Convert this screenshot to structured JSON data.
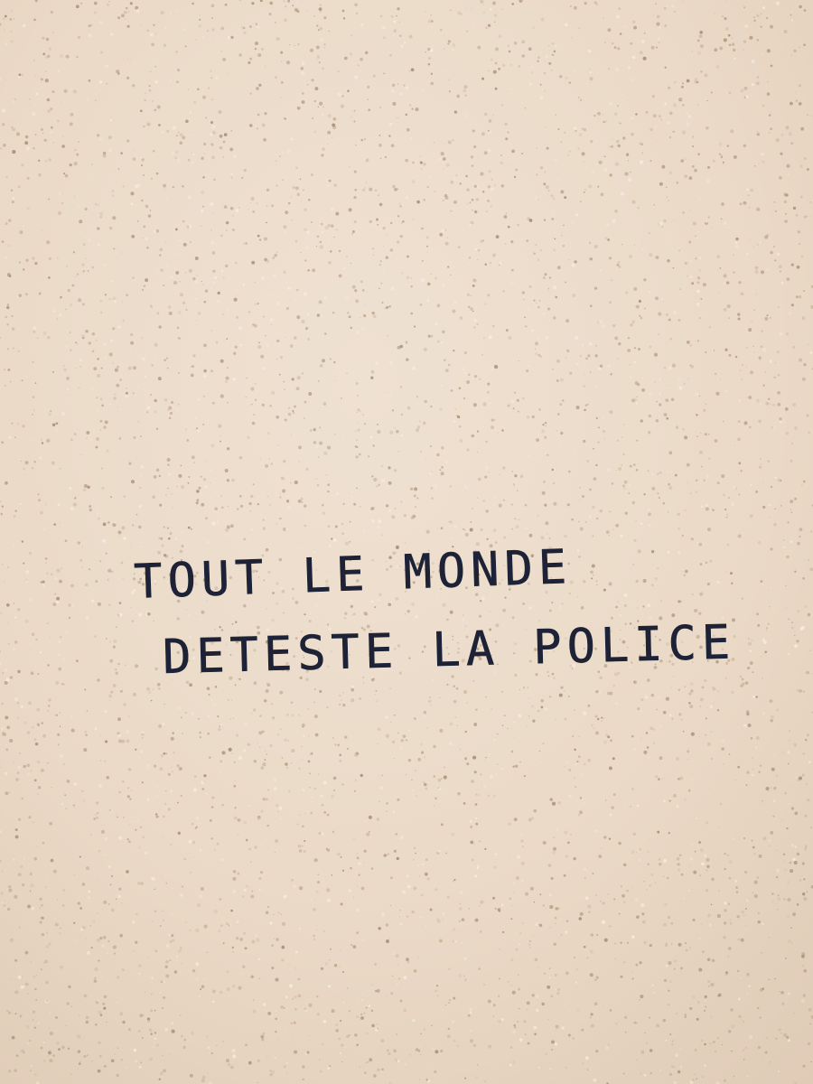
{
  "photo": {
    "subject": "hand-written graffiti on a textured plaster wall",
    "wall_color": "#ecdccb",
    "ink_color": "#1d2236",
    "graffiti": {
      "line1": "TOUT LE MONDE",
      "line2": "DETESTE LA POLICE"
    }
  }
}
